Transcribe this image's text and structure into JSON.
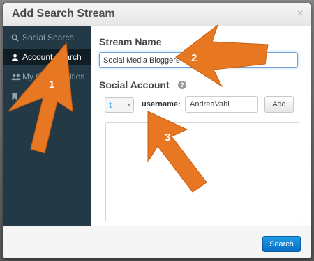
{
  "dialog": {
    "title": "Add Search Stream",
    "close_glyph": "×"
  },
  "sidebar": {
    "items": [
      {
        "label": "Social Search",
        "icon": "search-icon"
      },
      {
        "label": "Account Search",
        "icon": "user-icon",
        "active": true
      },
      {
        "label": "My Communities",
        "icon": "users-icon"
      },
      {
        "label": "Watchlist",
        "icon": "bookmark-icon"
      }
    ]
  },
  "form": {
    "stream_name_label": "Stream Name",
    "stream_name_value": "Social Media Bloggers",
    "social_account_label": "Social Account",
    "help_glyph": "?",
    "network": "twitter",
    "network_glyph": "t",
    "username_label": "username:",
    "username_value": "AndreaVahl",
    "add_label": "Add"
  },
  "footer": {
    "search_label": "Search"
  },
  "annotations": {
    "color": "#e87722",
    "labels": [
      "1",
      "2",
      "3"
    ]
  },
  "colors": {
    "sidebar_bg": "#243946",
    "sidebar_active": "#111d24",
    "primary_button": "#0a6fc4",
    "arrow": "#e87722"
  }
}
